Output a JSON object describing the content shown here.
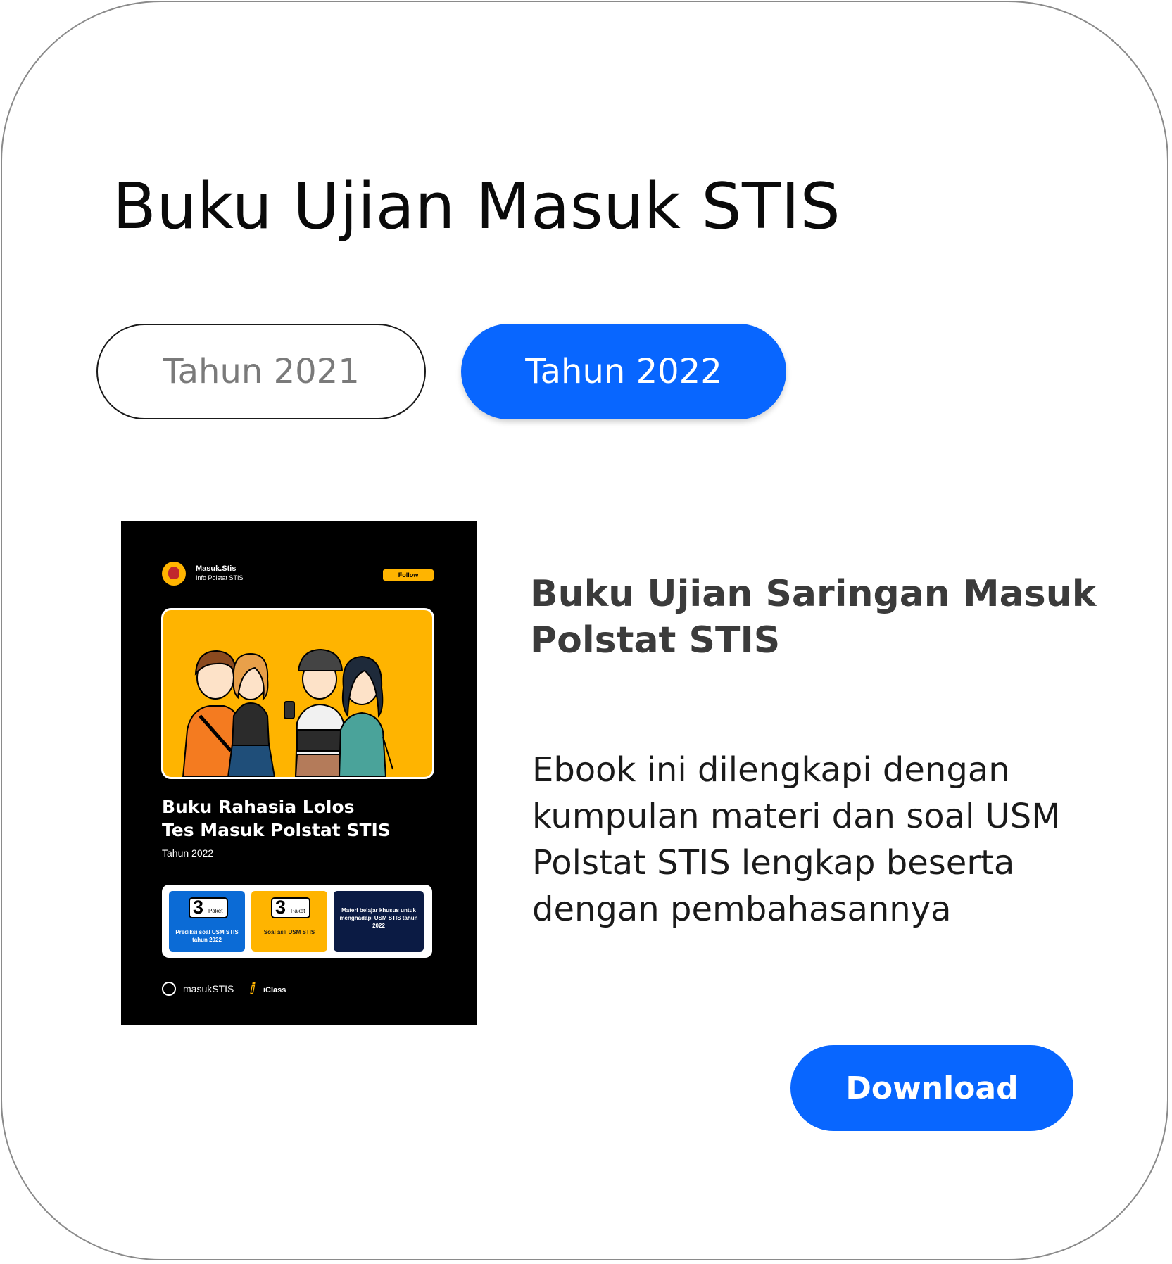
{
  "header": {
    "title": "Buku Ujian Masuk STIS"
  },
  "tabs": [
    {
      "label": "Tahun 2021",
      "active": false
    },
    {
      "label": "Tahun 2022",
      "active": true
    }
  ],
  "book": {
    "cover": {
      "account_name": "Masuk.Stis",
      "account_sub": "Info Polstat STIS",
      "follow_label": "Follow",
      "title_lines": [
        "Buku Rahasia Lolos",
        "Tes Masuk Polstat STIS"
      ],
      "year": "Tahun 2022",
      "features": [
        {
          "number": "3",
          "unit": "Paket",
          "text": "Prediksi soal USM STIS tahun 2022"
        },
        {
          "number": "3",
          "unit": "Paket",
          "text": "Soal asli USM STIS"
        },
        {
          "text": "Materi belajar khusus untuk menghadapi USM STIS tahun 2022"
        }
      ],
      "brand_1": "masukSTIS",
      "brand_2": "iClass"
    },
    "title_lines": [
      "Buku Ujian Saringan Masuk",
      "Polstat STIS"
    ],
    "description_lines": [
      "Ebook ini dilengkapi dengan",
      "kumpulan materi dan soal USM",
      "Polstat STIS lengkap beserta",
      "dengan pembahasannya"
    ],
    "download_label": "Download"
  },
  "colors": {
    "accent": "#0866ff",
    "cover_yellow": "#ffb400",
    "cover_bg": "#000000"
  }
}
